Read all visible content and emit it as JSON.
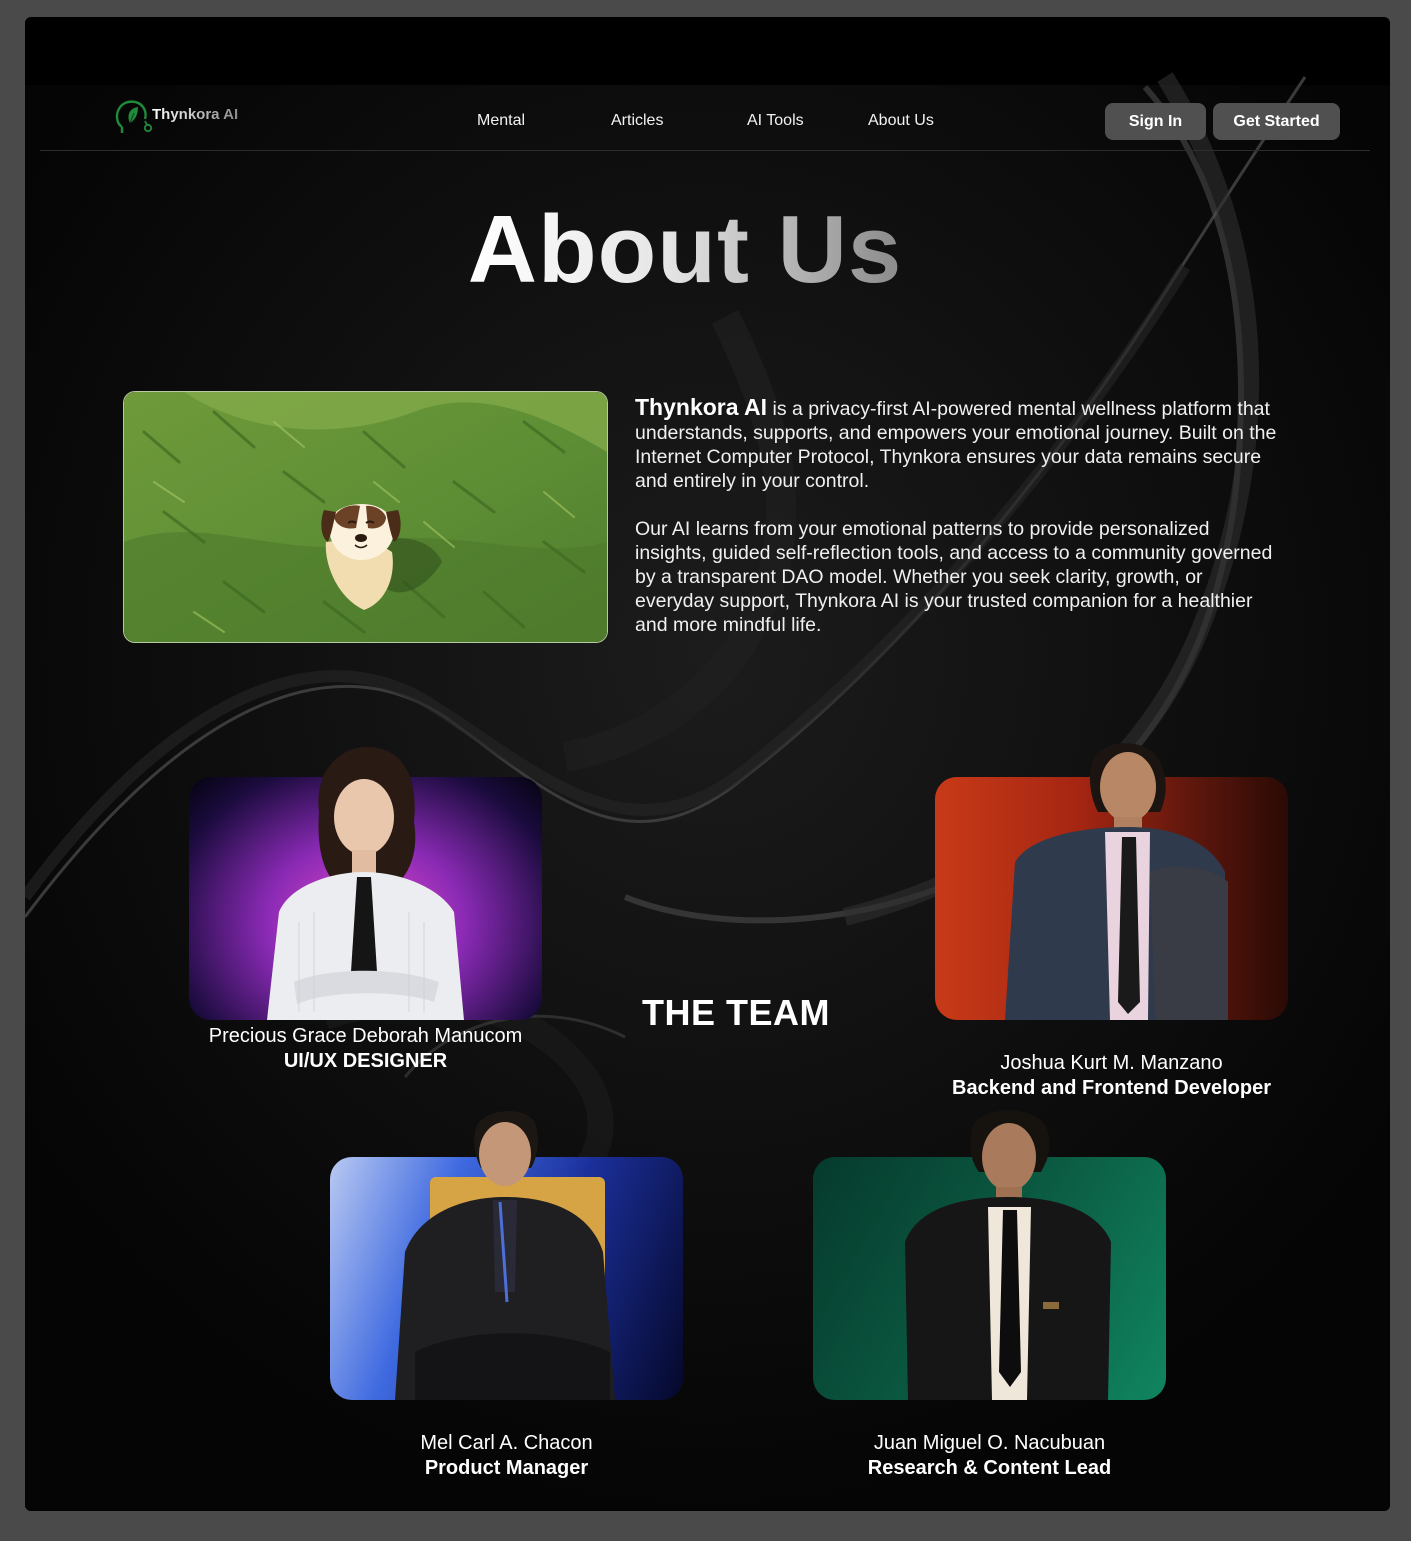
{
  "brand": {
    "name": "Thynkora AI",
    "logo_icon": "leaf-head-icon"
  },
  "nav": {
    "links": [
      "Mental",
      "Articles",
      "AI Tools",
      "About Us"
    ]
  },
  "auth": {
    "sign_in": "Sign In",
    "get_started": "Get Started"
  },
  "page": {
    "title": "About Us"
  },
  "about": {
    "brand_name": "Thynkora AI",
    "paragraph1_rest": " is a privacy-first AI-powered mental wellness platform that understands, supports, and empowers your emotional journey. Built on the Internet Computer Protocol, Thynkora ensures your data remains secure and entirely in your control.",
    "paragraph2": "Our AI learns from your emotional patterns to provide personalized insights, guided self-reflection tools, and access to a community governed by a transparent DAO model. Whether you seek clarity, growth, or everyday support, Thynkora AI is your trusted companion for a healthier and more mindful life."
  },
  "team": {
    "title": "THE TEAM",
    "members": [
      {
        "name": "Precious Grace Deborah Manucom",
        "role": "UI/UX DESIGNER"
      },
      {
        "name": "Joshua Kurt M. Manzano",
        "role": "Backend and Frontend Developer"
      },
      {
        "name": "Mel Carl A. Chacon",
        "role": "Product Manager"
      },
      {
        "name": "Juan Miguel O. Nacubuan",
        "role": "Research & Content Lead"
      }
    ]
  },
  "colors": {
    "page_bg": "#000000",
    "frame_bg": "#4a4a4a",
    "button_bg": "#505050",
    "logo_green": "#1f8a3a"
  }
}
